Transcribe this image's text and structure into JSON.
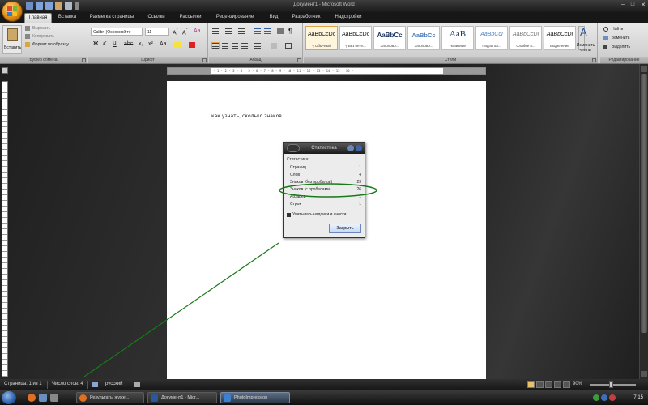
{
  "window": {
    "title": "Документ1 - Microsoft Word",
    "controls": [
      "–",
      "□",
      "✕"
    ]
  },
  "quick_access": [
    "save-icon",
    "undo-icon",
    "redo-icon",
    "print-preview-icon",
    "spelling-icon",
    "customize-icon"
  ],
  "tabs": [
    {
      "label": "Главная",
      "active": true
    },
    {
      "label": "Вставка"
    },
    {
      "label": "Разметка страницы"
    },
    {
      "label": "Ссылки"
    },
    {
      "label": "Рассылки"
    },
    {
      "label": "Рецензирование"
    },
    {
      "label": "Вид"
    },
    {
      "label": "Разработчик"
    },
    {
      "label": "Надстройки"
    }
  ],
  "ribbon": {
    "clipboard": {
      "label": "Буфер обмена",
      "paste": "Вставить",
      "cut": "Вырезать",
      "copy": "Копировать",
      "format_painter": "Формат по образцу"
    },
    "font": {
      "label": "Шрифт",
      "font_name": "Calibri (Основной те",
      "font_size": "11"
    },
    "paragraph": {
      "label": "Абзац"
    },
    "styles": {
      "label": "Стили",
      "items": [
        {
          "sample": "AaBbCcDc",
          "name": "¶ Обычный",
          "selected": true
        },
        {
          "sample": "AaBbCcDc",
          "name": "¶ Без инте..."
        },
        {
          "sample": "AaBbCc",
          "name": "Заголово..."
        },
        {
          "sample": "AaBbCc",
          "name": "Заголово..."
        },
        {
          "sample": "AaB",
          "name": "Название"
        },
        {
          "sample": "AaBbCcI",
          "name": "Подзагол..."
        },
        {
          "sample": "AaBbCcDi",
          "name": "Слабое в..."
        },
        {
          "sample": "AaBbCcDi",
          "name": "Выделение"
        }
      ],
      "change_styles": "Изменить стили"
    },
    "editing": {
      "label": "Редактирование",
      "find": "Найти",
      "replace": "Заменить",
      "select": "Выделить"
    }
  },
  "document": {
    "body_text": "как узнать, сколько знаков"
  },
  "dialog": {
    "title": "Статистика",
    "heading": "Статистика:",
    "rows": [
      {
        "label": "Страниц",
        "value": "1"
      },
      {
        "label": "Слов",
        "value": "4"
      },
      {
        "label": "Знаков (без пробелов)",
        "value": "23"
      },
      {
        "label": "Знаков (с пробелами)",
        "value": "26"
      },
      {
        "label": "Абзацев",
        "value": "1"
      },
      {
        "label": "Строк",
        "value": "1"
      }
    ],
    "include_label": "Учитывать надписи и сноски",
    "close_label": "Закрыть"
  },
  "status": {
    "page": "Страница: 1 из 1",
    "words": "Число слов: 4",
    "language": "русский",
    "zoom": "90%"
  },
  "taskbar": {
    "buttons": [
      {
        "label": "Результаты жуже...",
        "icon_color": "#e07020"
      },
      {
        "label": "Документ1 - Micr...",
        "icon_color": "#2b579a"
      },
      {
        "label": "PhotoImpression",
        "icon_color": "#3d7fd0",
        "active": true
      }
    ],
    "clock": "7:15"
  },
  "colors": {
    "annotation_green": "#1a7a1a",
    "ribbon_bg": "#dcdcdc",
    "dark_frame": "#1b1b1b"
  }
}
